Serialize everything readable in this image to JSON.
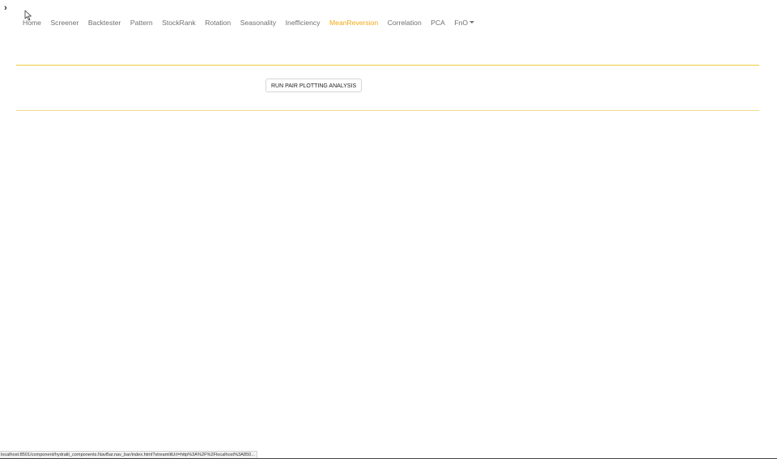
{
  "sidebar": {
    "toggle_glyph": "›",
    "icon": "chevron-right-icon"
  },
  "cursor": {
    "icon": "mouse-pointer-icon"
  },
  "navbar": {
    "items": [
      {
        "label": "Home",
        "active": false
      },
      {
        "label": "Screener",
        "active": false
      },
      {
        "label": "Backtester",
        "active": false
      },
      {
        "label": "Pattern",
        "active": false
      },
      {
        "label": "StockRank",
        "active": false
      },
      {
        "label": "Rotation",
        "active": false
      },
      {
        "label": "Seasonality",
        "active": false
      },
      {
        "label": "Inefficiency",
        "active": false
      },
      {
        "label": "MeanReversion",
        "active": true
      },
      {
        "label": "Correlation",
        "active": false
      },
      {
        "label": "PCA",
        "active": false
      },
      {
        "label": "FnO",
        "active": false,
        "dropdown": true
      }
    ],
    "dropdown_icon": "caret-down-icon"
  },
  "colors": {
    "active_nav": "#f0a814",
    "divider": "#f0cd3c",
    "nav_text": "#6f6f6f"
  },
  "main": {
    "run_button_label": "RUN PAIR PLOTTING ANALYSIS"
  },
  "status_bar": {
    "url": "localhost:8501/component/hydralit_components.NavBar.nav_bar/index.html?streamlitUrl=http%3A%2F%2Flocalhost%3A850..."
  }
}
